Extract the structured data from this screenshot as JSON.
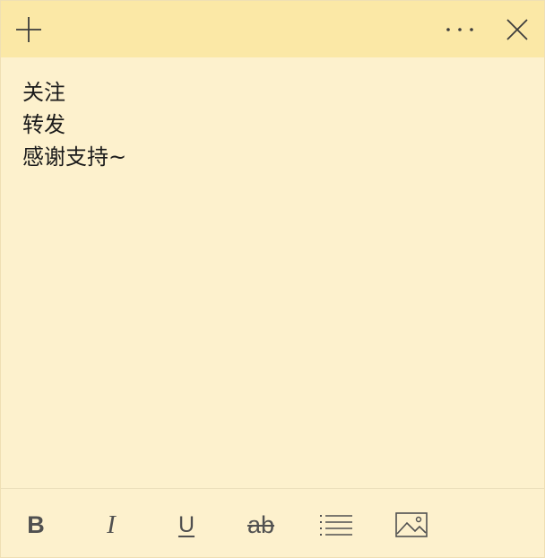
{
  "note": {
    "lines": [
      "关注",
      "转发",
      "感谢支持~"
    ]
  },
  "titlebar": {
    "new_note_icon": "plus-icon",
    "more_icon": "ellipsis-icon",
    "close_icon": "close-icon"
  },
  "toolbar": {
    "bold": "B",
    "italic": "I",
    "underline": "U",
    "strikethrough": "ab",
    "list_icon": "bullet-list-icon",
    "image_icon": "image-icon"
  },
  "colors": {
    "header": "#fbe8a6",
    "body": "#fdf1cd",
    "icon": "#505050"
  }
}
